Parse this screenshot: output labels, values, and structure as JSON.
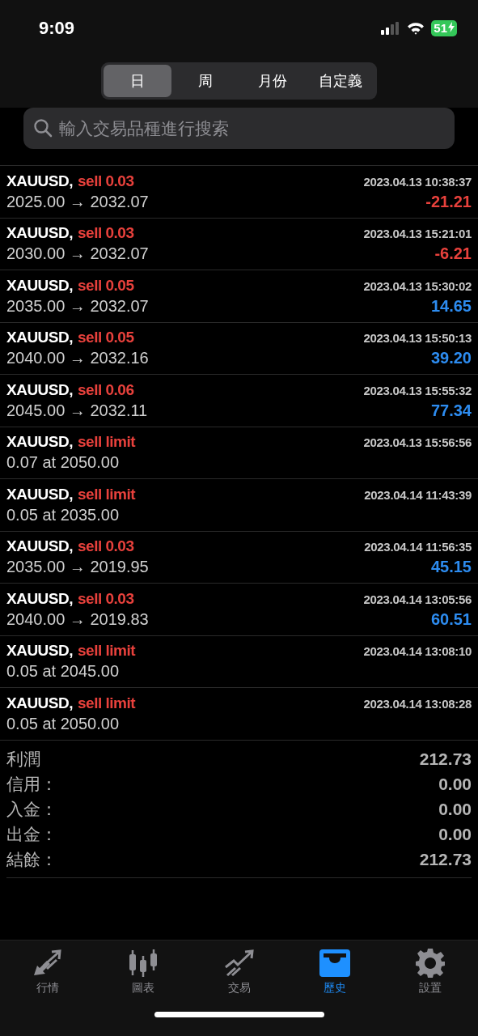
{
  "status_bar": {
    "time": "9:09",
    "battery": "51"
  },
  "segments": [
    {
      "label": "日",
      "selected": true
    },
    {
      "label": "周",
      "selected": false
    },
    {
      "label": "月份",
      "selected": false
    },
    {
      "label": "自定義",
      "selected": false
    }
  ],
  "search": {
    "placeholder": "輸入交易品種進行搜索"
  },
  "orders": [
    {
      "symbol": "XAUUSD,",
      "action": "sell 0.03",
      "time": "2023.04.13 10:38:37",
      "detail": "2025.00 → 2032.07",
      "profit": "-21.21",
      "color": "#e8413c"
    },
    {
      "symbol": "XAUUSD,",
      "action": "sell 0.03",
      "time": "2023.04.13 15:21:01",
      "detail": "2030.00 → 2032.07",
      "profit": "-6.21",
      "color": "#e8413c"
    },
    {
      "symbol": "XAUUSD,",
      "action": "sell 0.05",
      "time": "2023.04.13 15:30:02",
      "detail": "2035.00 → 2032.07",
      "profit": "14.65",
      "color": "#2d8cf0"
    },
    {
      "symbol": "XAUUSD,",
      "action": "sell 0.05",
      "time": "2023.04.13 15:50:13",
      "detail": "2040.00 → 2032.16",
      "profit": "39.20",
      "color": "#2d8cf0"
    },
    {
      "symbol": "XAUUSD,",
      "action": "sell 0.06",
      "time": "2023.04.13 15:55:32",
      "detail": "2045.00 → 2032.11",
      "profit": "77.34",
      "color": "#2d8cf0"
    },
    {
      "symbol": "XAUUSD,",
      "action": "sell limit",
      "time": "2023.04.13 15:56:56",
      "detail": "0.07 at 2050.00"
    },
    {
      "symbol": "XAUUSD,",
      "action": "sell limit",
      "time": "2023.04.14 11:43:39",
      "detail": "0.05 at 2035.00"
    },
    {
      "symbol": "XAUUSD,",
      "action": "sell 0.03",
      "time": "2023.04.14 11:56:35",
      "detail": "2035.00 → 2019.95",
      "profit": "45.15",
      "color": "#2d8cf0"
    },
    {
      "symbol": "XAUUSD,",
      "action": "sell 0.03",
      "time": "2023.04.14 13:05:56",
      "detail": "2040.00 → 2019.83",
      "profit": "60.51",
      "color": "#2d8cf0"
    },
    {
      "symbol": "XAUUSD,",
      "action": "sell limit",
      "time": "2023.04.14 13:08:10",
      "detail": "0.05 at 2045.00"
    },
    {
      "symbol": "XAUUSD,",
      "action": "sell limit",
      "time": "2023.04.14 13:08:28",
      "detail": "0.05 at 2050.00"
    }
  ],
  "summary": [
    {
      "label": "利潤",
      "value": "212.73"
    },
    {
      "label": "信用：",
      "value": "0.00"
    },
    {
      "label": "入金：",
      "value": "0.00"
    },
    {
      "label": "出金：",
      "value": "0.00"
    },
    {
      "label": "結餘：",
      "value": "212.73"
    }
  ],
  "tab_bar": [
    {
      "label": "行情",
      "selected": false
    },
    {
      "label": "圖表",
      "selected": false
    },
    {
      "label": "交易",
      "selected": false
    },
    {
      "label": "歷史",
      "selected": true
    },
    {
      "label": "設置",
      "selected": false
    }
  ]
}
